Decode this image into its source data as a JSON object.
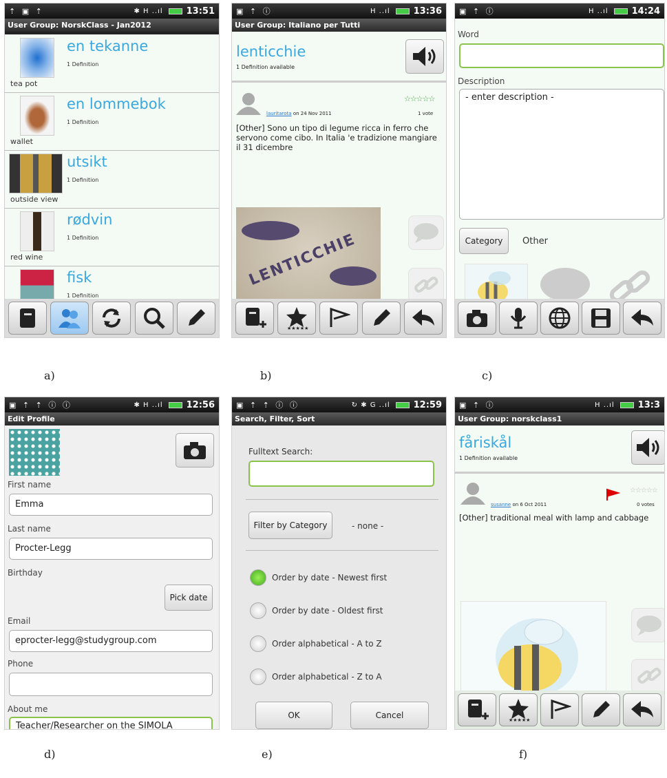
{
  "status": {
    "a": {
      "time": "13:51"
    },
    "b": {
      "time": "13:36"
    },
    "c": {
      "time": "14:24"
    },
    "d": {
      "time": "12:56"
    },
    "e": {
      "time": "12:59"
    },
    "f": {
      "time": "13:3"
    }
  },
  "screen_a": {
    "title": "User Group: NorskClass - Jan2012",
    "items": [
      {
        "word": "en tekanne",
        "defs": "1 Definition",
        "translation": "tea pot"
      },
      {
        "word": "en lommebok",
        "defs": "1 Definition",
        "translation": "wallet"
      },
      {
        "word": "utsikt",
        "defs": "1 Definition",
        "translation": "outside view"
      },
      {
        "word": "rødvin",
        "defs": "1 Definition",
        "translation": "red wine"
      },
      {
        "word": "fisk",
        "defs": "1 Definition",
        "translation": ""
      }
    ]
  },
  "screen_b": {
    "title": "User Group: Italiano per Tutti",
    "word": "lenticchie",
    "available": "1 Definition available",
    "user": "lauritarota",
    "date": "on 24 Nov 2011",
    "votes": "1 vote",
    "rating": 5,
    "text": "[Other] Sono un tipo di legume ricca in ferro che servono come cibo. In Italia 'e tradizione mangiare il 31 dicembre",
    "photo_text": "LENTICCHIE"
  },
  "screen_c": {
    "word_label": "Word",
    "word_value": "",
    "desc_label": "Description",
    "desc_placeholder": "- enter description -",
    "category_button": "Category",
    "category_value": "Other"
  },
  "screen_d": {
    "title": "Edit Profile",
    "first_label": "First name",
    "first_value": "Emma",
    "last_label": "Last name",
    "last_value": "Procter-Legg",
    "birthday_label": "Birthday",
    "pick_date": "Pick date",
    "email_label": "Email",
    "email_value": "eprocter-legg@studygroup.com",
    "phone_label": "Phone",
    "phone_value": "",
    "about_label": "About me",
    "about_value": "Teacher/Researcher on the SIMOLA project!"
  },
  "screen_e": {
    "title": "Search, Filter, Sort",
    "search_label": "Fulltext Search:",
    "filter_button": "Filter by Category",
    "filter_value": "- none -",
    "options": [
      "Order by date - Newest first",
      "Order by date - Oldest first",
      "Order alphabetical - A to Z",
      "Order alphabetical - Z to A"
    ],
    "selected": 0,
    "ok": "OK",
    "cancel": "Cancel"
  },
  "screen_f": {
    "title": "User Group: norskclass1",
    "word": "fåriskål",
    "available": "1 Definition available",
    "user": "susanne",
    "date": "on  6 Oct 2011",
    "votes": "0 votes",
    "text": "[Other] traditional meal with lamp and cabbage"
  },
  "captions": [
    "a)",
    "b)",
    "c)",
    "d)",
    "e)",
    "f)"
  ],
  "colors": {
    "accent": "#3aa8e0",
    "title_bar": "#2a2a2a",
    "focus": "#8bc34a",
    "star": "#4a4"
  }
}
